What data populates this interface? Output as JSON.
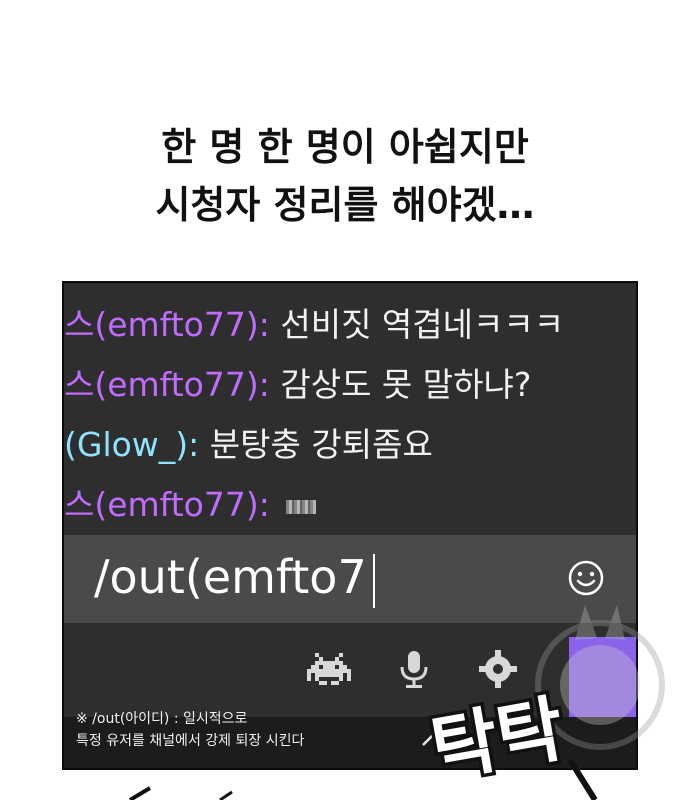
{
  "narration": {
    "line1": "한 명 한 명이 아쉽지만",
    "line2": "시청자 정리를 해야겠…"
  },
  "chat": {
    "messages": [
      {
        "user": "스(emfto77)",
        "separator": ":",
        "text": "선비짓 역겹네ㅋㅋㅋ",
        "user_color": "#c06cff"
      },
      {
        "user": "스(emfto77)",
        "separator": ":",
        "text": "감상도 못 말하냐?",
        "user_color": "#c06cff"
      },
      {
        "user": "(Glow_)",
        "separator": ":",
        "text": "분탕충 강퇴좀요",
        "user_color": "#8fe3ff"
      },
      {
        "user": "스(emfto77)",
        "separator": ":",
        "text": "",
        "user_color": "#c06cff"
      }
    ]
  },
  "input": {
    "value": "/out(emfto7"
  },
  "toolbar": {
    "icons": [
      "smiley-icon",
      "space-invader-icon",
      "microphone-icon",
      "gear-icon",
      "chevron-up-icon"
    ],
    "send_color": "#8a63e8"
  },
  "hint": {
    "line1": "※ /out(아이디) : 일시적으로",
    "line2": "특정 유저를 채널에서 강제 퇴장 시킨다"
  },
  "sfx": {
    "text": "탁탁"
  }
}
